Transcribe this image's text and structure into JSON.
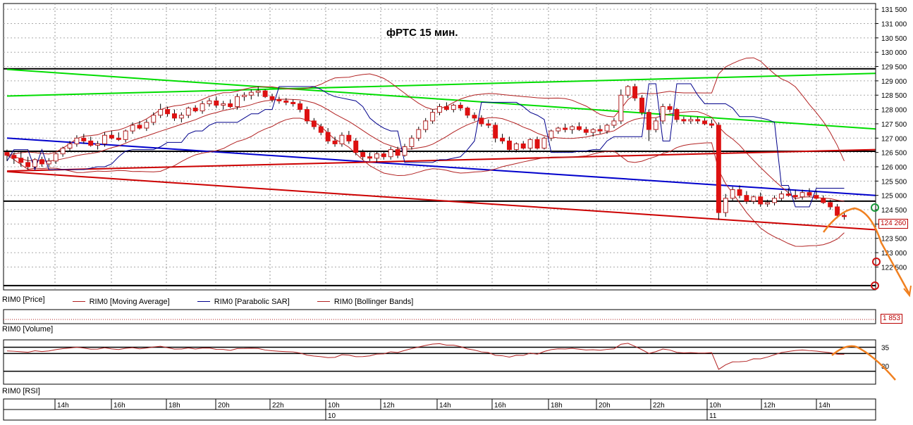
{
  "chart_data": {
    "type": "candlestick",
    "title": "фРТС   15 мин.",
    "instrument": "RIM0",
    "timeframe": "15 мин.",
    "x_labels": [
      "14h",
      "16h",
      "18h",
      "20h",
      "22h",
      "10h",
      "12h",
      "14h",
      "16h",
      "18h",
      "20h",
      "22h",
      "10h",
      "12h",
      "14h"
    ],
    "date_labels": [
      {
        "label": "10",
        "at_index": 5
      },
      {
        "label": "11",
        "at_index": 12
      }
    ],
    "price_axis": {
      "ylim": [
        121700,
        131700
      ],
      "ticks": [
        131500,
        131000,
        130500,
        130000,
        129500,
        129000,
        128500,
        128000,
        127500,
        127000,
        126500,
        126000,
        125500,
        125000,
        124500,
        124000,
        123500,
        123000,
        122500
      ],
      "tick_labels": [
        "131 500",
        "131 000",
        "130 500",
        "130 000",
        "129 500",
        "129 000",
        "128 500",
        "128 000",
        "127 500",
        "127 000",
        "126 500",
        "126 000",
        "125 500",
        "125 000",
        "124 500",
        "124 000",
        "123 500",
        "123 000",
        "122 500"
      ]
    },
    "last_price": "124 260",
    "last_price_value": 124260,
    "volume_value_label": "1 853",
    "rsi_axis": {
      "ticks": [
        35,
        30
      ],
      "tick_labels": [
        "35",
        "30"
      ],
      "ylim": [
        25,
        37
      ]
    },
    "legend": [
      {
        "name": "RIM0 [Price]",
        "color": "#000000"
      },
      {
        "name": "RIM0 [Moving Average]",
        "color": "#b22222"
      },
      {
        "name": "RIM0 [Parabolic SAR]",
        "color": "#00008b"
      },
      {
        "name": "RIM0 [Bollinger Bands]",
        "color": "#b22222"
      }
    ],
    "panels": {
      "volume": "RIM0 [Volume]",
      "rsi": "RIM0 [RSI]"
    },
    "horizontal_levels": [
      129420,
      126540,
      124800,
      121850
    ],
    "trendlines": [
      {
        "color": "#00dd00",
        "from": [
          0,
          128470
        ],
        "to": [
          155,
          129260
        ]
      },
      {
        "color": "#00dd00",
        "from": [
          0,
          129400
        ],
        "to": [
          155,
          127320
        ]
      },
      {
        "color": "#0000cc",
        "from": [
          0,
          127000
        ],
        "to": [
          155,
          125000
        ]
      },
      {
        "color": "#cc0000",
        "from": [
          0,
          125850
        ],
        "to": [
          155,
          126600
        ]
      },
      {
        "color": "#cc0000",
        "from": [
          0,
          125830
        ],
        "to": [
          155,
          123800
        ]
      }
    ],
    "candles": [
      [
        126500,
        126600,
        126200,
        126400
      ],
      [
        126400,
        126500,
        126100,
        126300
      ],
      [
        126300,
        126550,
        126000,
        126150
      ],
      [
        126150,
        126350,
        125900,
        126000
      ],
      [
        126000,
        126300,
        125950,
        126250
      ],
      [
        126250,
        126350,
        126000,
        126100
      ],
      [
        126100,
        126300,
        126000,
        126200
      ],
      [
        126200,
        126500,
        126100,
        126450
      ],
      [
        126450,
        126700,
        126350,
        126650
      ],
      [
        126650,
        126900,
        126550,
        126800
      ],
      [
        126800,
        127100,
        126700,
        127000
      ],
      [
        127000,
        127150,
        126800,
        126900
      ],
      [
        126900,
        127050,
        126700,
        126750
      ],
      [
        126750,
        126900,
        126600,
        126800
      ],
      [
        126800,
        127200,
        126700,
        127100
      ],
      [
        127100,
        127250,
        126950,
        127000
      ],
      [
        127000,
        127200,
        126900,
        126950
      ],
      [
        126950,
        127300,
        126850,
        127250
      ],
      [
        127250,
        127550,
        127150,
        127450
      ],
      [
        127450,
        127600,
        127300,
        127350
      ],
      [
        127350,
        127650,
        127250,
        127550
      ],
      [
        127550,
        127900,
        127450,
        127800
      ],
      [
        127800,
        128200,
        127700,
        128000
      ],
      [
        128000,
        128100,
        127750,
        127850
      ],
      [
        127850,
        128000,
        127600,
        127700
      ],
      [
        127700,
        127900,
        127550,
        127800
      ],
      [
        127800,
        128100,
        127700,
        128050
      ],
      [
        128050,
        128150,
        127900,
        127950
      ],
      [
        127950,
        128300,
        127850,
        128200
      ],
      [
        128200,
        128400,
        128100,
        128300
      ],
      [
        128300,
        128450,
        128050,
        128150
      ],
      [
        128150,
        128300,
        128000,
        128200
      ],
      [
        128200,
        128350,
        128050,
        128100
      ],
      [
        128100,
        128550,
        128000,
        128450
      ],
      [
        128450,
        128600,
        128300,
        128500
      ],
      [
        128500,
        128700,
        128350,
        128600
      ],
      [
        128600,
        128800,
        128450,
        128650
      ],
      [
        128650,
        128700,
        128400,
        128450
      ],
      [
        128450,
        128550,
        128250,
        128350
      ],
      [
        128350,
        128450,
        128200,
        128300
      ],
      [
        128300,
        128400,
        128150,
        128250
      ],
      [
        128250,
        128350,
        128100,
        128200
      ],
      [
        128200,
        128300,
        127900,
        128000
      ],
      [
        128000,
        128100,
        127500,
        127600
      ],
      [
        127600,
        127700,
        127300,
        127400
      ],
      [
        127400,
        127500,
        127100,
        127200
      ],
      [
        127200,
        127350,
        126800,
        126900
      ],
      [
        126900,
        127050,
        126700,
        126800
      ],
      [
        126800,
        127200,
        126700,
        127100
      ],
      [
        127100,
        127250,
        126800,
        126900
      ],
      [
        126900,
        127000,
        126400,
        126500
      ],
      [
        126500,
        126600,
        126250,
        126350
      ],
      [
        126350,
        126500,
        126200,
        126300
      ],
      [
        126300,
        126550,
        126150,
        126450
      ],
      [
        126450,
        126550,
        126250,
        126350
      ],
      [
        126350,
        126700,
        126250,
        126600
      ],
      [
        126600,
        126700,
        126300,
        126400
      ],
      [
        126400,
        126800,
        126350,
        126700
      ],
      [
        126700,
        127100,
        126600,
        127000
      ],
      [
        127000,
        127400,
        126900,
        127300
      ],
      [
        127300,
        127700,
        127200,
        127600
      ],
      [
        127600,
        128000,
        127500,
        127900
      ],
      [
        127900,
        128200,
        127800,
        128100
      ],
      [
        128100,
        128250,
        127950,
        128000
      ],
      [
        128000,
        128200,
        127900,
        128150
      ],
      [
        128150,
        128250,
        127950,
        128050
      ],
      [
        128050,
        128100,
        127700,
        127800
      ],
      [
        127800,
        127900,
        127600,
        127700
      ],
      [
        127700,
        127800,
        127400,
        127500
      ],
      [
        127500,
        127650,
        127350,
        127450
      ],
      [
        127450,
        127550,
        126850,
        127000
      ],
      [
        127000,
        127150,
        126800,
        126900
      ],
      [
        126900,
        127050,
        126550,
        126600
      ],
      [
        126600,
        126850,
        126500,
        126800
      ],
      [
        126800,
        126900,
        126600,
        126650
      ],
      [
        126650,
        127000,
        126550,
        126950
      ],
      [
        126950,
        127050,
        126600,
        126650
      ],
      [
        126650,
        127050,
        126600,
        127000
      ],
      [
        127000,
        127300,
        126900,
        127250
      ],
      [
        127250,
        127400,
        127150,
        127350
      ],
      [
        127350,
        127500,
        127200,
        127300
      ],
      [
        127300,
        127450,
        127150,
        127400
      ],
      [
        127400,
        127550,
        127250,
        127300
      ],
      [
        127300,
        127400,
        127100,
        127200
      ],
      [
        127200,
        127350,
        127050,
        127300
      ],
      [
        127300,
        127450,
        127150,
        127250
      ],
      [
        127250,
        127500,
        127150,
        127450
      ],
      [
        127450,
        127700,
        127350,
        127600
      ],
      [
        127600,
        128700,
        127500,
        128500
      ],
      [
        128500,
        128850,
        128400,
        128800
      ],
      [
        128800,
        128900,
        128300,
        128400
      ],
      [
        128400,
        128500,
        127800,
        127900
      ],
      [
        127900,
        128000,
        126900,
        127300
      ],
      [
        127300,
        127700,
        127200,
        127600
      ],
      [
        127600,
        128200,
        127500,
        128100
      ],
      [
        128100,
        128200,
        127900,
        128000
      ],
      [
        128000,
        128050,
        127550,
        127650
      ],
      [
        127650,
        127750,
        127500,
        127600
      ],
      [
        127600,
        127750,
        127500,
        127650
      ],
      [
        127650,
        127750,
        127500,
        127600
      ],
      [
        127600,
        127700,
        127450,
        127500
      ],
      [
        127500,
        127650,
        127350,
        127450
      ],
      [
        127450,
        127550,
        124150,
        124400
      ],
      [
        124400,
        125050,
        124250,
        124900
      ],
      [
        124900,
        125300,
        124800,
        125200
      ],
      [
        125200,
        125350,
        124900,
        125000
      ],
      [
        125000,
        125150,
        124700,
        124800
      ],
      [
        124800,
        125000,
        124700,
        124950
      ],
      [
        124950,
        125100,
        124600,
        124700
      ],
      [
        124700,
        124850,
        124600,
        124750
      ],
      [
        124750,
        125000,
        124650,
        124900
      ],
      [
        124900,
        125150,
        124800,
        125050
      ],
      [
        125050,
        125250,
        124950,
        125000
      ],
      [
        125000,
        125200,
        124850,
        124950
      ],
      [
        124950,
        125200,
        124850,
        125100
      ],
      [
        125100,
        125250,
        124950,
        125000
      ],
      [
        125000,
        125150,
        124850,
        124900
      ],
      [
        124900,
        125000,
        124700,
        124750
      ],
      [
        124750,
        124850,
        124500,
        124600
      ],
      [
        124600,
        124700,
        124200,
        124300
      ],
      [
        124300,
        124400,
        124150,
        124260
      ]
    ]
  }
}
